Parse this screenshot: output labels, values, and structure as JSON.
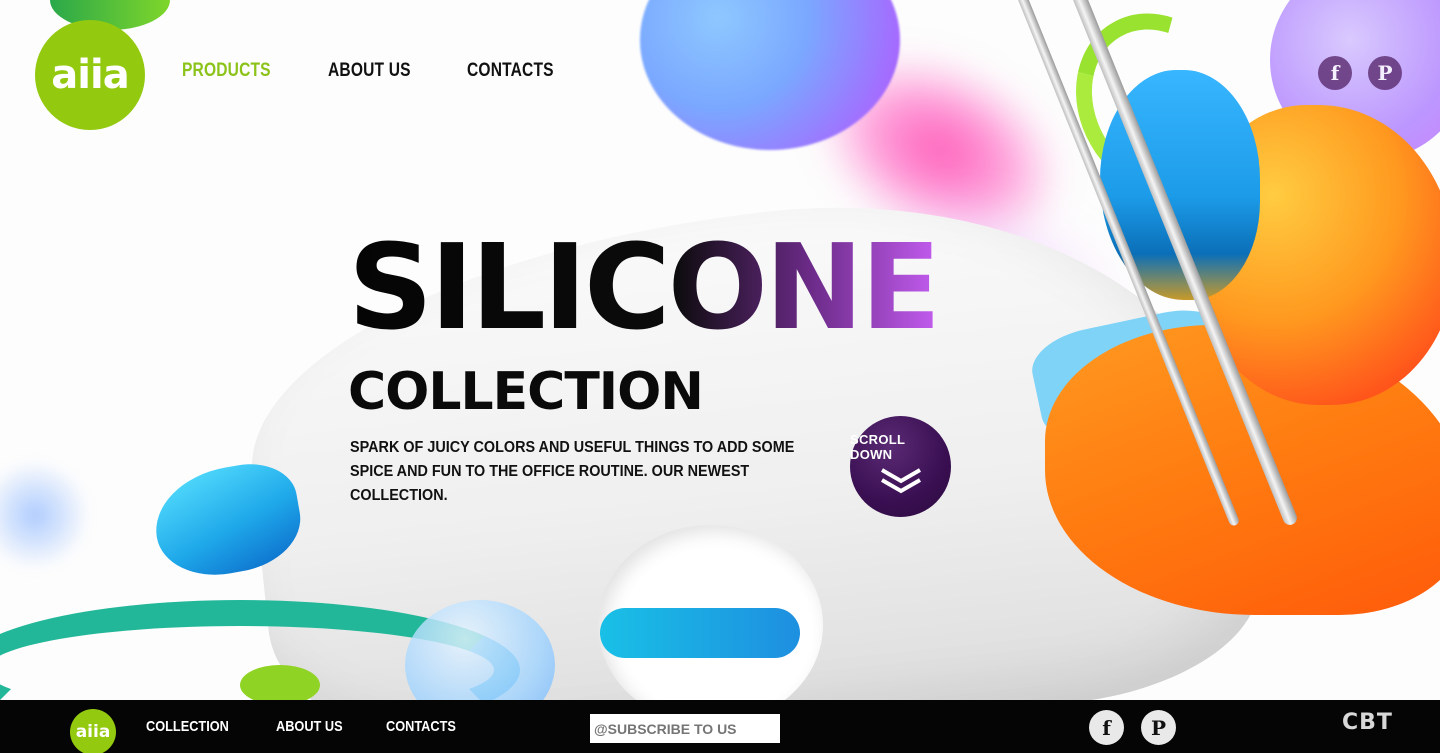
{
  "brand": {
    "logo_text": "aiia",
    "accent_color": "#93c90f"
  },
  "nav": {
    "items": [
      {
        "label": "PRODUCTS",
        "active": true
      },
      {
        "label": "ABOUT US",
        "active": false
      },
      {
        "label": "CONTACTS",
        "active": false
      }
    ],
    "active_color": "#8cc31a"
  },
  "social_top": [
    {
      "icon": "facebook-icon",
      "glyph": "f"
    },
    {
      "icon": "pinterest-icon",
      "glyph": "P"
    }
  ],
  "hero": {
    "title": "SILICONE",
    "subtitle": "COLLECTION",
    "description": "SPARK OF JUICY COLORS AND USEFUL THINGS TO ADD SOME SPICE AND FUN TO THE OFFICE ROUTINE. OUR NEWEST COLLECTION.",
    "scroll_label": "SCROLL DOWN",
    "scroll_color": "#3a0f52"
  },
  "footer": {
    "logo_text": "aiia",
    "nav": [
      "COLLECTION",
      "ABOUT US",
      "CONTACTS"
    ],
    "subscribe_placeholder": "@SUBSCRIBE TO US",
    "social": [
      {
        "icon": "facebook-icon",
        "glyph": "f"
      },
      {
        "icon": "pinterest-icon",
        "glyph": "P"
      }
    ],
    "credit": "CBT"
  }
}
